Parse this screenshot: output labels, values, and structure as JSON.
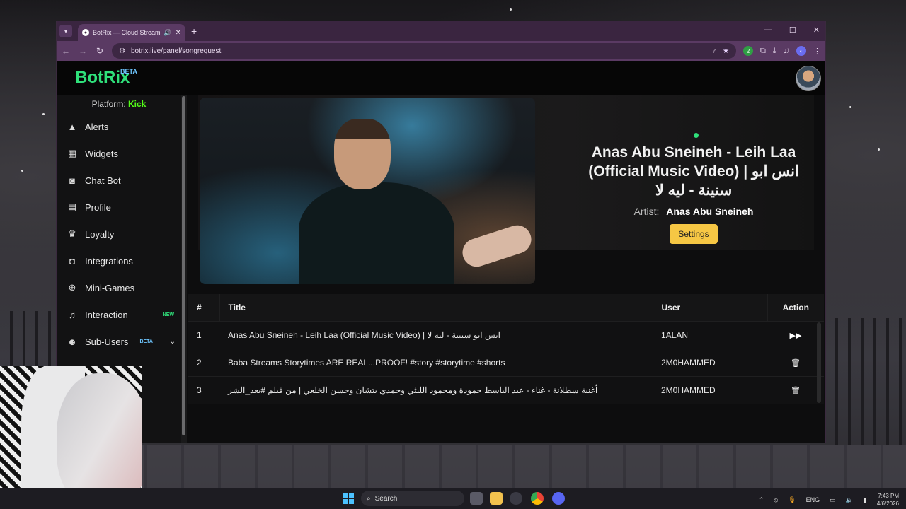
{
  "browser": {
    "tab_title": "BotRix — Cloud Streaming",
    "url": "botrix.live/panel/songrequest"
  },
  "header": {
    "logo": "BotRix",
    "logo_badge": "BETA"
  },
  "sidebar": {
    "platform_label": "Platform:",
    "platform_value": "Kick",
    "items": [
      {
        "label": "Alerts",
        "icon": "warning-icon"
      },
      {
        "label": "Widgets",
        "icon": "widgets-icon"
      },
      {
        "label": "Chat Bot",
        "icon": "robot-icon"
      },
      {
        "label": "Profile",
        "icon": "id-card-icon"
      },
      {
        "label": "Loyalty",
        "icon": "trophy-icon"
      },
      {
        "label": "Integrations",
        "icon": "discord-icon"
      },
      {
        "label": "Mini-Games",
        "icon": "gamepad-icon"
      },
      {
        "label": "Interaction",
        "icon": "music-icon",
        "badge": "NEW"
      },
      {
        "label": "Sub-Users",
        "icon": "users-icon",
        "badge": "BETA"
      }
    ]
  },
  "now_playing": {
    "title": "Anas Abu Sneineh - Leih Laa (Official Music Video) | انس ابو سنينة - ليه لا",
    "artist_label": "Artist:",
    "artist": "Anas Abu Sneineh",
    "settings_label": "Settings"
  },
  "queue": {
    "headers": [
      "#",
      "Title",
      "User",
      "Action"
    ],
    "rows": [
      {
        "num": "1",
        "title": "Anas Abu Sneineh - Leih Laa (Official Music Video) | انس ابو سنينة - ليه لا",
        "user": "1ALAN",
        "action": "skip"
      },
      {
        "num": "2",
        "title": "Baba Streams Storytimes ARE REAL...PROOF! #story #storytime #shorts",
        "user": "2M0HAMMED",
        "action": "delete"
      },
      {
        "num": "3",
        "title": "أغنية سطلانة - غناء - عبد الباسط حمودة ومحمود الليثي وحمدي بتشان وحسن الخلعي | من فيلم #بعد_الشر",
        "user": "2M0HAMMED",
        "action": "delete"
      }
    ]
  },
  "taskbar": {
    "search_label": "Search",
    "language": "ENG",
    "time": "7:43 PM",
    "date": "4/6/2026"
  },
  "colors": {
    "accent_green": "#2fe07a",
    "kick_green": "#53fc18",
    "settings_yellow": "#f6c744",
    "beta_blue": "#6ec6ff"
  }
}
